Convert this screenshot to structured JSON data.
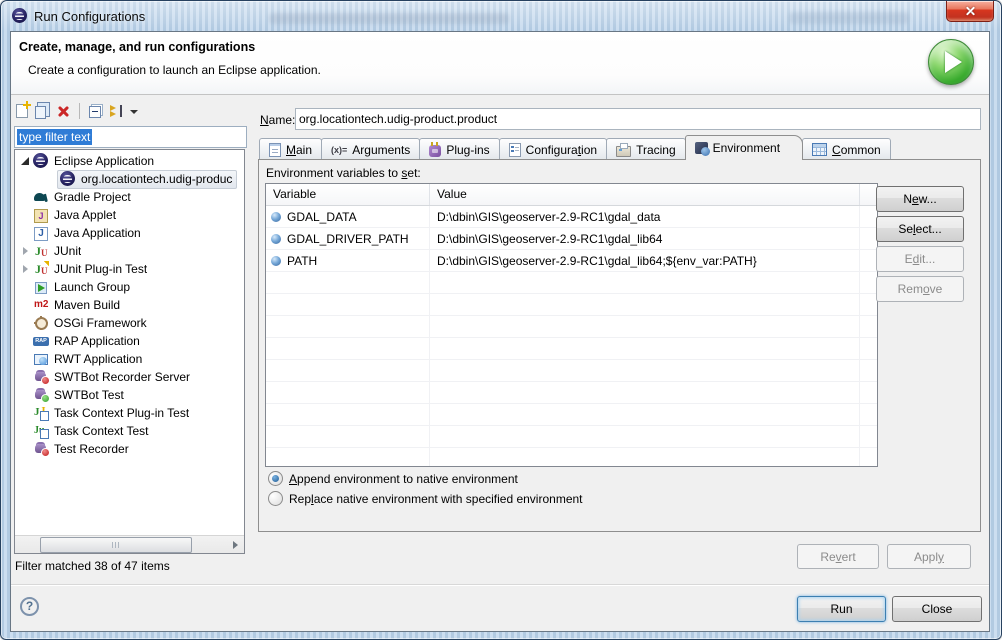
{
  "colors": {
    "close_red": "#c33220",
    "run_green": "#2f9e28",
    "selection_blue": "#2f7cd6",
    "aero_blue": "#b7cfe6",
    "eclipse_navy": "#262260"
  },
  "window": {
    "title": "Run Configurations"
  },
  "banner": {
    "title": "Create, manage, and run configurations",
    "subtitle": "Create a configuration to launch an Eclipse application."
  },
  "sidebar": {
    "filter_text": "type filter text",
    "status": "Filter matched 38 of 47 items",
    "tree": [
      {
        "label": "Eclipse Application",
        "icon": "eclipse-icon",
        "state": "expanded"
      },
      {
        "label": "org.locationtech.udig-produc",
        "icon": "eclipse-icon",
        "selected": true
      },
      {
        "label": "Gradle Project",
        "icon": "gradle-icon"
      },
      {
        "label": "Java Applet",
        "icon": "java-applet-icon"
      },
      {
        "label": "Java Application",
        "icon": "java-application-icon"
      },
      {
        "label": "JUnit",
        "icon": "junit-icon",
        "state": "collapsed"
      },
      {
        "label": "JUnit Plug-in Test",
        "icon": "junit-plugin-icon",
        "state": "collapsed"
      },
      {
        "label": "Launch Group",
        "icon": "launch-group-icon"
      },
      {
        "label": "Maven Build",
        "icon": "maven-icon"
      },
      {
        "label": "OSGi Framework",
        "icon": "osgi-icon"
      },
      {
        "label": "RAP Application",
        "icon": "rap-icon"
      },
      {
        "label": "RWT Application",
        "icon": "rwt-icon"
      },
      {
        "label": "SWTBot Recorder Server",
        "icon": "swtbot-recorder-icon"
      },
      {
        "label": "SWTBot Test",
        "icon": "swtbot-test-icon"
      },
      {
        "label": "Task Context Plug-in Test",
        "icon": "task-context-plugin-icon"
      },
      {
        "label": "Task Context Test",
        "icon": "task-context-icon"
      },
      {
        "label": "Test Recorder",
        "icon": "test-recorder-icon"
      }
    ]
  },
  "main": {
    "name_label": "&Name:",
    "name_value": "org.locationtech.udig-product.product",
    "tabs": [
      {
        "label": "&Main"
      },
      {
        "label": "Arguments"
      },
      {
        "label": "Plug-ins"
      },
      {
        "label": "Configura&tion"
      },
      {
        "label": "Tracin&g"
      },
      {
        "label": "Environment",
        "active": true
      },
      {
        "label": "&Common"
      }
    ],
    "env": {
      "caption": "Environment variables to &set:",
      "columns": [
        "Variable",
        "Value"
      ],
      "rows": [
        {
          "variable": "GDAL_DATA",
          "value": "D:\\dbin\\GIS\\geoserver-2.9-RC1\\gdal_data"
        },
        {
          "variable": "GDAL_DRIVER_PATH",
          "value": "D:\\dbin\\GIS\\geoserver-2.9-RC1\\gdal_lib64"
        },
        {
          "variable": "PATH",
          "value": "D:\\dbin\\GIS\\geoserver-2.9-RC1\\gdal_lib64;${env_var:PATH}"
        }
      ],
      "buttons": {
        "new": "N&ew...",
        "select": "Se&lect...",
        "edit": "E&dit...",
        "remove": "Rem&ove"
      },
      "radios": [
        {
          "label": "&Append environment to native environment",
          "selected": true
        },
        {
          "label": "Rep&lace native environment with specified environment",
          "selected": false
        }
      ]
    },
    "revert": "Re&vert",
    "apply": "Appl&y"
  },
  "footer": {
    "run": "Run",
    "close": "Close"
  }
}
